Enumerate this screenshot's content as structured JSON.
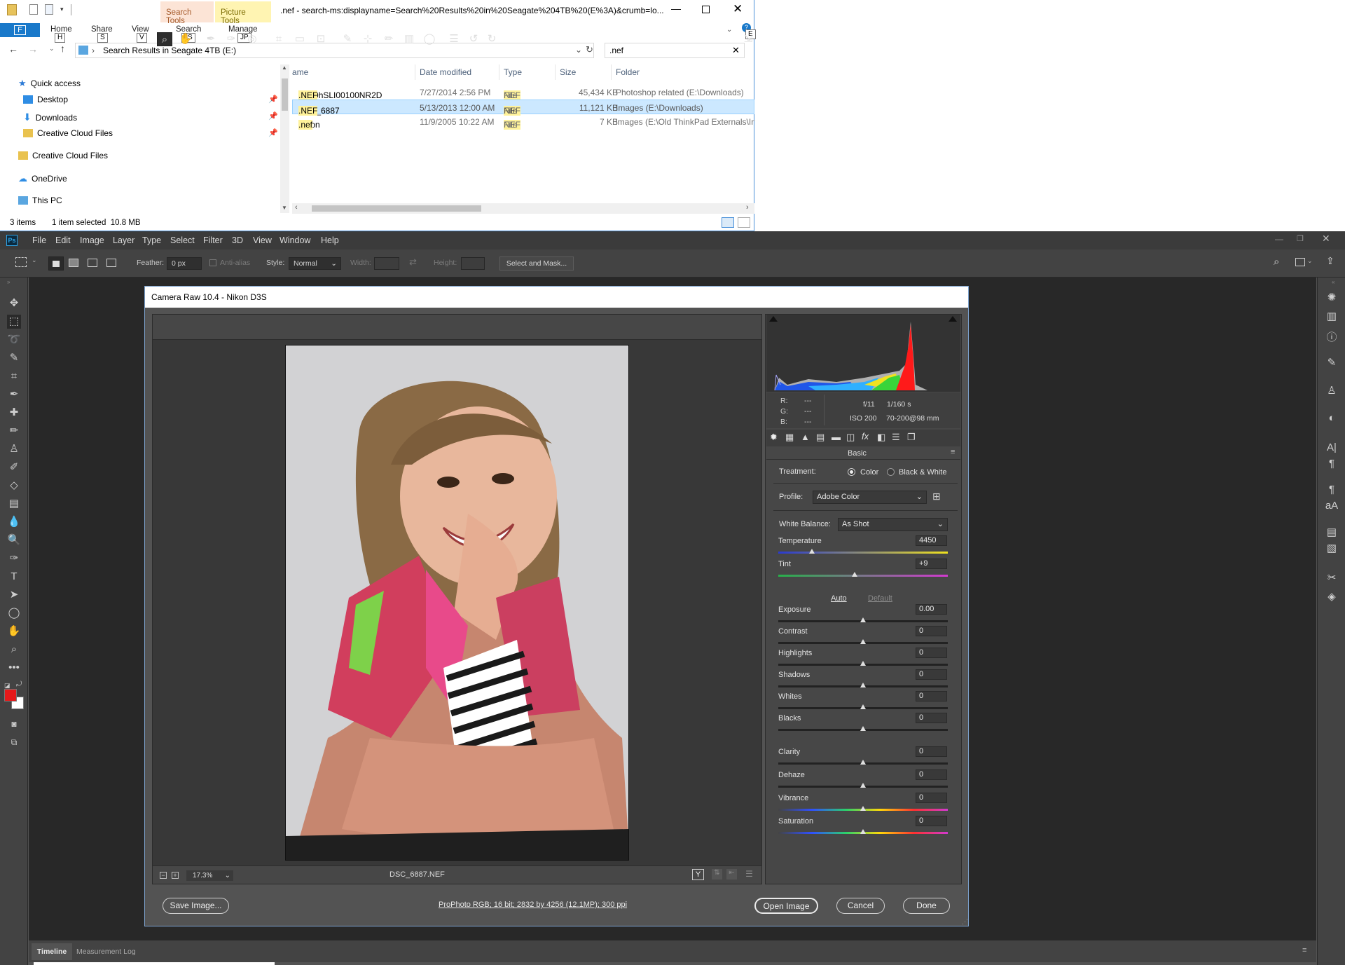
{
  "explorer": {
    "title": ".nef - search-ms:displayname=Search%20Results%20in%20Seagate%204TB%20(E%3A)&crumb=lo...",
    "context_tabs": [
      "Search Tools",
      "Picture Tools"
    ],
    "file_tab": "F",
    "ribbon_tabs": [
      "Home",
      "Share",
      "View",
      "Search",
      "Manage"
    ],
    "keytips": [
      "H",
      "S",
      "V",
      "JS",
      "JP",
      "E"
    ],
    "address": "Search Results in Seagate 4TB (E:)",
    "search_value": ".nef",
    "nav": [
      "Quick access",
      "Desktop",
      "Downloads",
      "Creative Cloud Files",
      "Creative Cloud Files",
      "OneDrive",
      "This PC"
    ],
    "columns": [
      "ame",
      "Date modified",
      "Type",
      "Size",
      "Folder"
    ],
    "files": [
      {
        "name": "D810hSLI00100NR2D",
        "ext": ".NEF",
        "date": "7/27/2014 2:56 PM",
        "type_hl": "NEF",
        "type": " File",
        "size": "45,434 KB",
        "folder": "Photoshop related (E:\\Downloads)"
      },
      {
        "name": "DSC_6887",
        "ext": ".NEF",
        "date": "5/13/2013 12:00 AM",
        "type_hl": "NEF",
        "type": " File",
        "size": "11,121 KB",
        "folder": "Images (E:\\Downloads)"
      },
      {
        "name": "Nikon",
        "ext": ".nef",
        "date": "11/9/2005 10:22 AM",
        "type_hl": "NEF",
        "type": " File",
        "size": "7 KB",
        "folder": "images (E:\\Old ThinkPad Externals\\Ins"
      }
    ],
    "status_items": "3 items",
    "status_selected": "1 item selected  10.8 MB"
  },
  "photoshop": {
    "menu": [
      "File",
      "Edit",
      "Image",
      "Layer",
      "Type",
      "Select",
      "Filter",
      "3D",
      "View",
      "Window",
      "Help"
    ],
    "options": {
      "feather_label": "Feather:",
      "feather_value": "0 px",
      "antialias": "Anti-alias",
      "style_label": "Style:",
      "style_value": "Normal",
      "width_label": "Width:",
      "height_label": "Height:",
      "select_mask": "Select and Mask..."
    },
    "bottom_tabs": [
      "Timeline",
      "Measurement Log"
    ],
    "foreground_color": "#e5191a"
  },
  "acr": {
    "title": "Camera Raw 10.4  -  Nikon D3S",
    "zoom": "17.3%",
    "filename": "DSC_6887.NEF",
    "rgb_labels": [
      "R:",
      "G:",
      "B:"
    ],
    "rgb_values": [
      "---",
      "---",
      "---"
    ],
    "exif": {
      "aperture": "f/11",
      "shutter": "1/160 s",
      "iso": "ISO 200",
      "lens": "70-200@98 mm"
    },
    "panel_title": "Basic",
    "treatment_label": "Treatment:",
    "treatment_color": "Color",
    "treatment_bw": "Black & White",
    "profile_label": "Profile:",
    "profile_value": "Adobe Color",
    "wb_label": "White Balance:",
    "wb_value": "As Shot",
    "auto": "Auto",
    "default": "Default",
    "sliders": [
      {
        "label": "Temperature",
        "value": "4450",
        "pos": 0.2
      },
      {
        "label": "Tint",
        "value": "+9",
        "pos": 0.45
      },
      {
        "label": "Exposure",
        "value": "0.00",
        "pos": 0.5
      },
      {
        "label": "Contrast",
        "value": "0",
        "pos": 0.5
      },
      {
        "label": "Highlights",
        "value": "0",
        "pos": 0.5
      },
      {
        "label": "Shadows",
        "value": "0",
        "pos": 0.5
      },
      {
        "label": "Whites",
        "value": "0",
        "pos": 0.5
      },
      {
        "label": "Blacks",
        "value": "0",
        "pos": 0.5
      },
      {
        "label": "Clarity",
        "value": "0",
        "pos": 0.5
      },
      {
        "label": "Dehaze",
        "value": "0",
        "pos": 0.5
      },
      {
        "label": "Vibrance",
        "value": "0",
        "pos": 0.5
      },
      {
        "label": "Saturation",
        "value": "0",
        "pos": 0.5
      }
    ],
    "save_image": "Save Image...",
    "workflow": "ProPhoto RGB; 16 bit; 2832 by 4256 (12.1MP); 300 ppi",
    "open_image": "Open Image",
    "cancel": "Cancel",
    "done": "Done"
  }
}
